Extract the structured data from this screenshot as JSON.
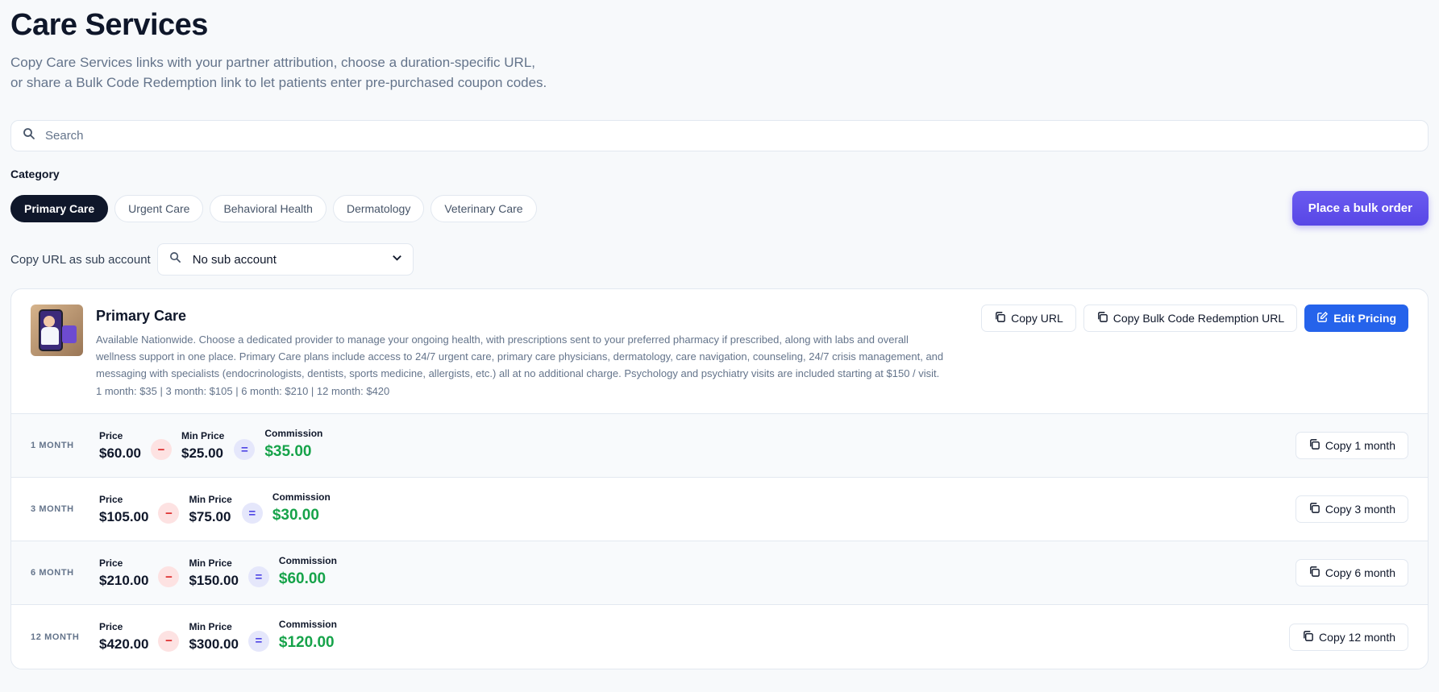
{
  "header": {
    "title": "Care Services",
    "subtitle_line1": "Copy Care Services links with your partner attribution, choose a duration-specific URL,",
    "subtitle_line2": "or share a Bulk Code Redemption link to let patients enter pre-purchased coupon codes."
  },
  "search": {
    "placeholder": "Search"
  },
  "category": {
    "label": "Category",
    "chips": [
      "Primary Care",
      "Urgent Care",
      "Behavioral Health",
      "Dermatology",
      "Veterinary Care"
    ],
    "active": "Primary Care"
  },
  "bulk_order_label": "Place a bulk order",
  "sub_account": {
    "label": "Copy URL as sub account",
    "selected": "No sub account"
  },
  "service": {
    "title": "Primary Care",
    "description": "Available Nationwide. Choose a dedicated provider to manage your ongoing health, with prescriptions sent to your preferred pharmacy if prescribed, along with labs and overall wellness support in one place. Primary Care plans include access to 24/7 urgent care, primary care physicians, dermatology, care navigation, counseling, 24/7 crisis management, and messaging with specialists (endocrinologists, dentists, sports medicine, allergists, etc.) all at no additional charge. Psychology and psychiatry visits are included starting at $150 / visit.",
    "price_summary": "1 month: $35 | 3 month: $105 | 6 month: $210 | 12 month: $420",
    "copy_url_label": "Copy URL",
    "copy_bulk_label": "Copy Bulk Code Redemption URL",
    "edit_pricing_label": "Edit Pricing"
  },
  "labels": {
    "price": "Price",
    "min_price": "Min Price",
    "commission": "Commission",
    "minus": "−",
    "equals": "="
  },
  "rows": [
    {
      "duration": "1 MONTH",
      "price": "$60.00",
      "min_price": "$25.00",
      "commission": "$35.00",
      "copy_label": "Copy 1 month"
    },
    {
      "duration": "3 MONTH",
      "price": "$105.00",
      "min_price": "$75.00",
      "commission": "$30.00",
      "copy_label": "Copy 3 month"
    },
    {
      "duration": "6 MONTH",
      "price": "$210.00",
      "min_price": "$150.00",
      "commission": "$60.00",
      "copy_label": "Copy 6 month"
    },
    {
      "duration": "12 MONTH",
      "price": "$420.00",
      "min_price": "$300.00",
      "commission": "$120.00",
      "copy_label": "Copy 12 month"
    }
  ],
  "colors": {
    "accent_blue": "#2563eb",
    "bulk_purple": "#5846e6",
    "commission_green": "#16a34a"
  },
  "icons": {
    "search": "search-icon",
    "copy": "copy-icon",
    "edit": "edit-icon",
    "chevron": "chevron-down-icon"
  }
}
